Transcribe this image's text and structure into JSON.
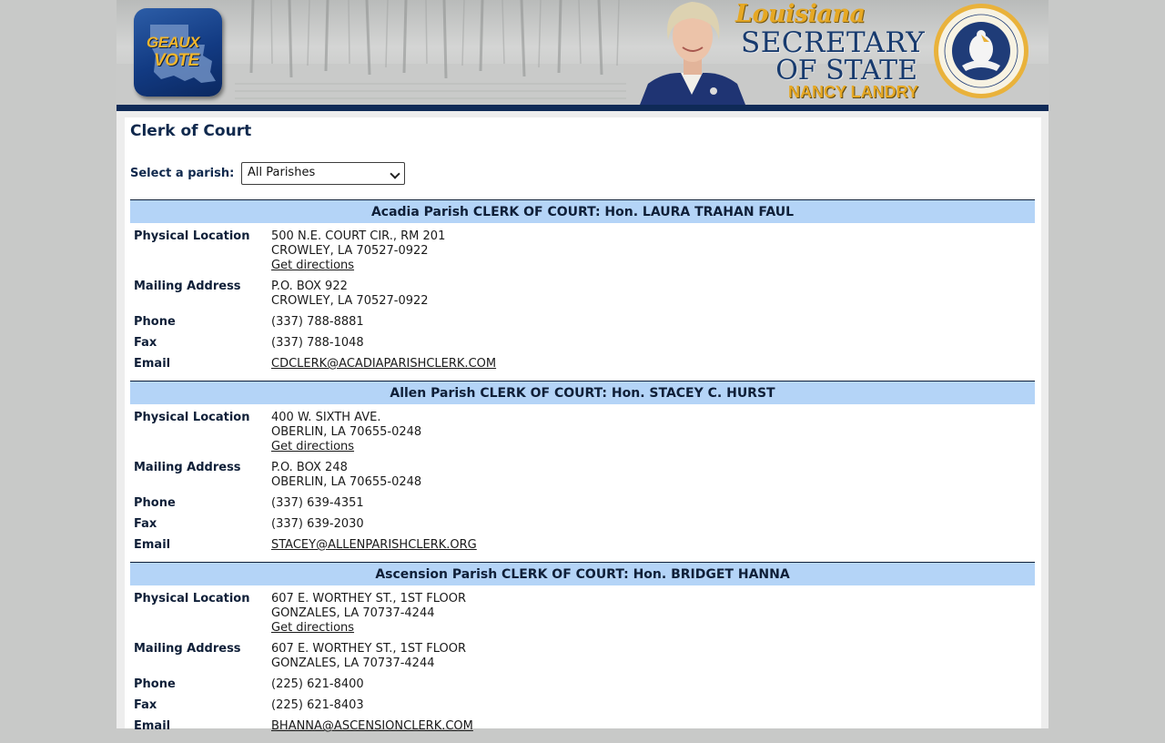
{
  "banner": {
    "logo_line1": "GEAUX",
    "logo_line2": "VOTE",
    "state_script": "Louisiana",
    "title_line1": "SECRETARY",
    "title_line2": "OF STATE",
    "official_name": "NANCY LANDRY",
    "seal_text": "STATE OF LOUISIANA · SECRETARY OF STATE",
    "colors": {
      "navy": "#0f2a57",
      "gold": "#e6a824"
    }
  },
  "page": {
    "title": "Clerk of Court",
    "select_label": "Select a parish:",
    "select_value": "All Parishes"
  },
  "labels": {
    "physical": "Physical Location",
    "mailing": "Mailing Address",
    "phone": "Phone",
    "fax": "Fax",
    "email": "Email",
    "directions": "Get directions"
  },
  "records": [
    {
      "header": "Acadia Parish CLERK OF COURT: Hon. LAURA TRAHAN FAUL",
      "physical_1": "500 N.E. COURT CIR., RM 201",
      "physical_2": "CROWLEY, LA 70527-0922",
      "mailing_1": "P.O. BOX 922",
      "mailing_2": "CROWLEY, LA 70527-0922",
      "phone": "(337) 788-8881",
      "fax": "(337) 788-1048",
      "email": "CDCLERK@ACADIAPARISHCLERK.COM"
    },
    {
      "header": "Allen Parish CLERK OF COURT: Hon. STACEY C. HURST",
      "physical_1": "400 W. SIXTH AVE.",
      "physical_2": "OBERLIN, LA 70655-0248",
      "mailing_1": "P.O. BOX 248",
      "mailing_2": "OBERLIN, LA 70655-0248",
      "phone": "(337) 639-4351",
      "fax": "(337) 639-2030",
      "email": "STACEY@ALLENPARISHCLERK.ORG"
    },
    {
      "header": "Ascension Parish CLERK OF COURT: Hon. BRIDGET HANNA",
      "physical_1": "607 E. WORTHEY ST., 1ST FLOOR",
      "physical_2": "GONZALES, LA 70737-4244",
      "mailing_1": "607 E. WORTHEY ST., 1ST FLOOR",
      "mailing_2": "GONZALES, LA 70737-4244",
      "phone": "(225) 621-8400",
      "fax": "(225) 621-8403",
      "email": "BHANNA@ASCENSIONCLERK.COM"
    }
  ]
}
